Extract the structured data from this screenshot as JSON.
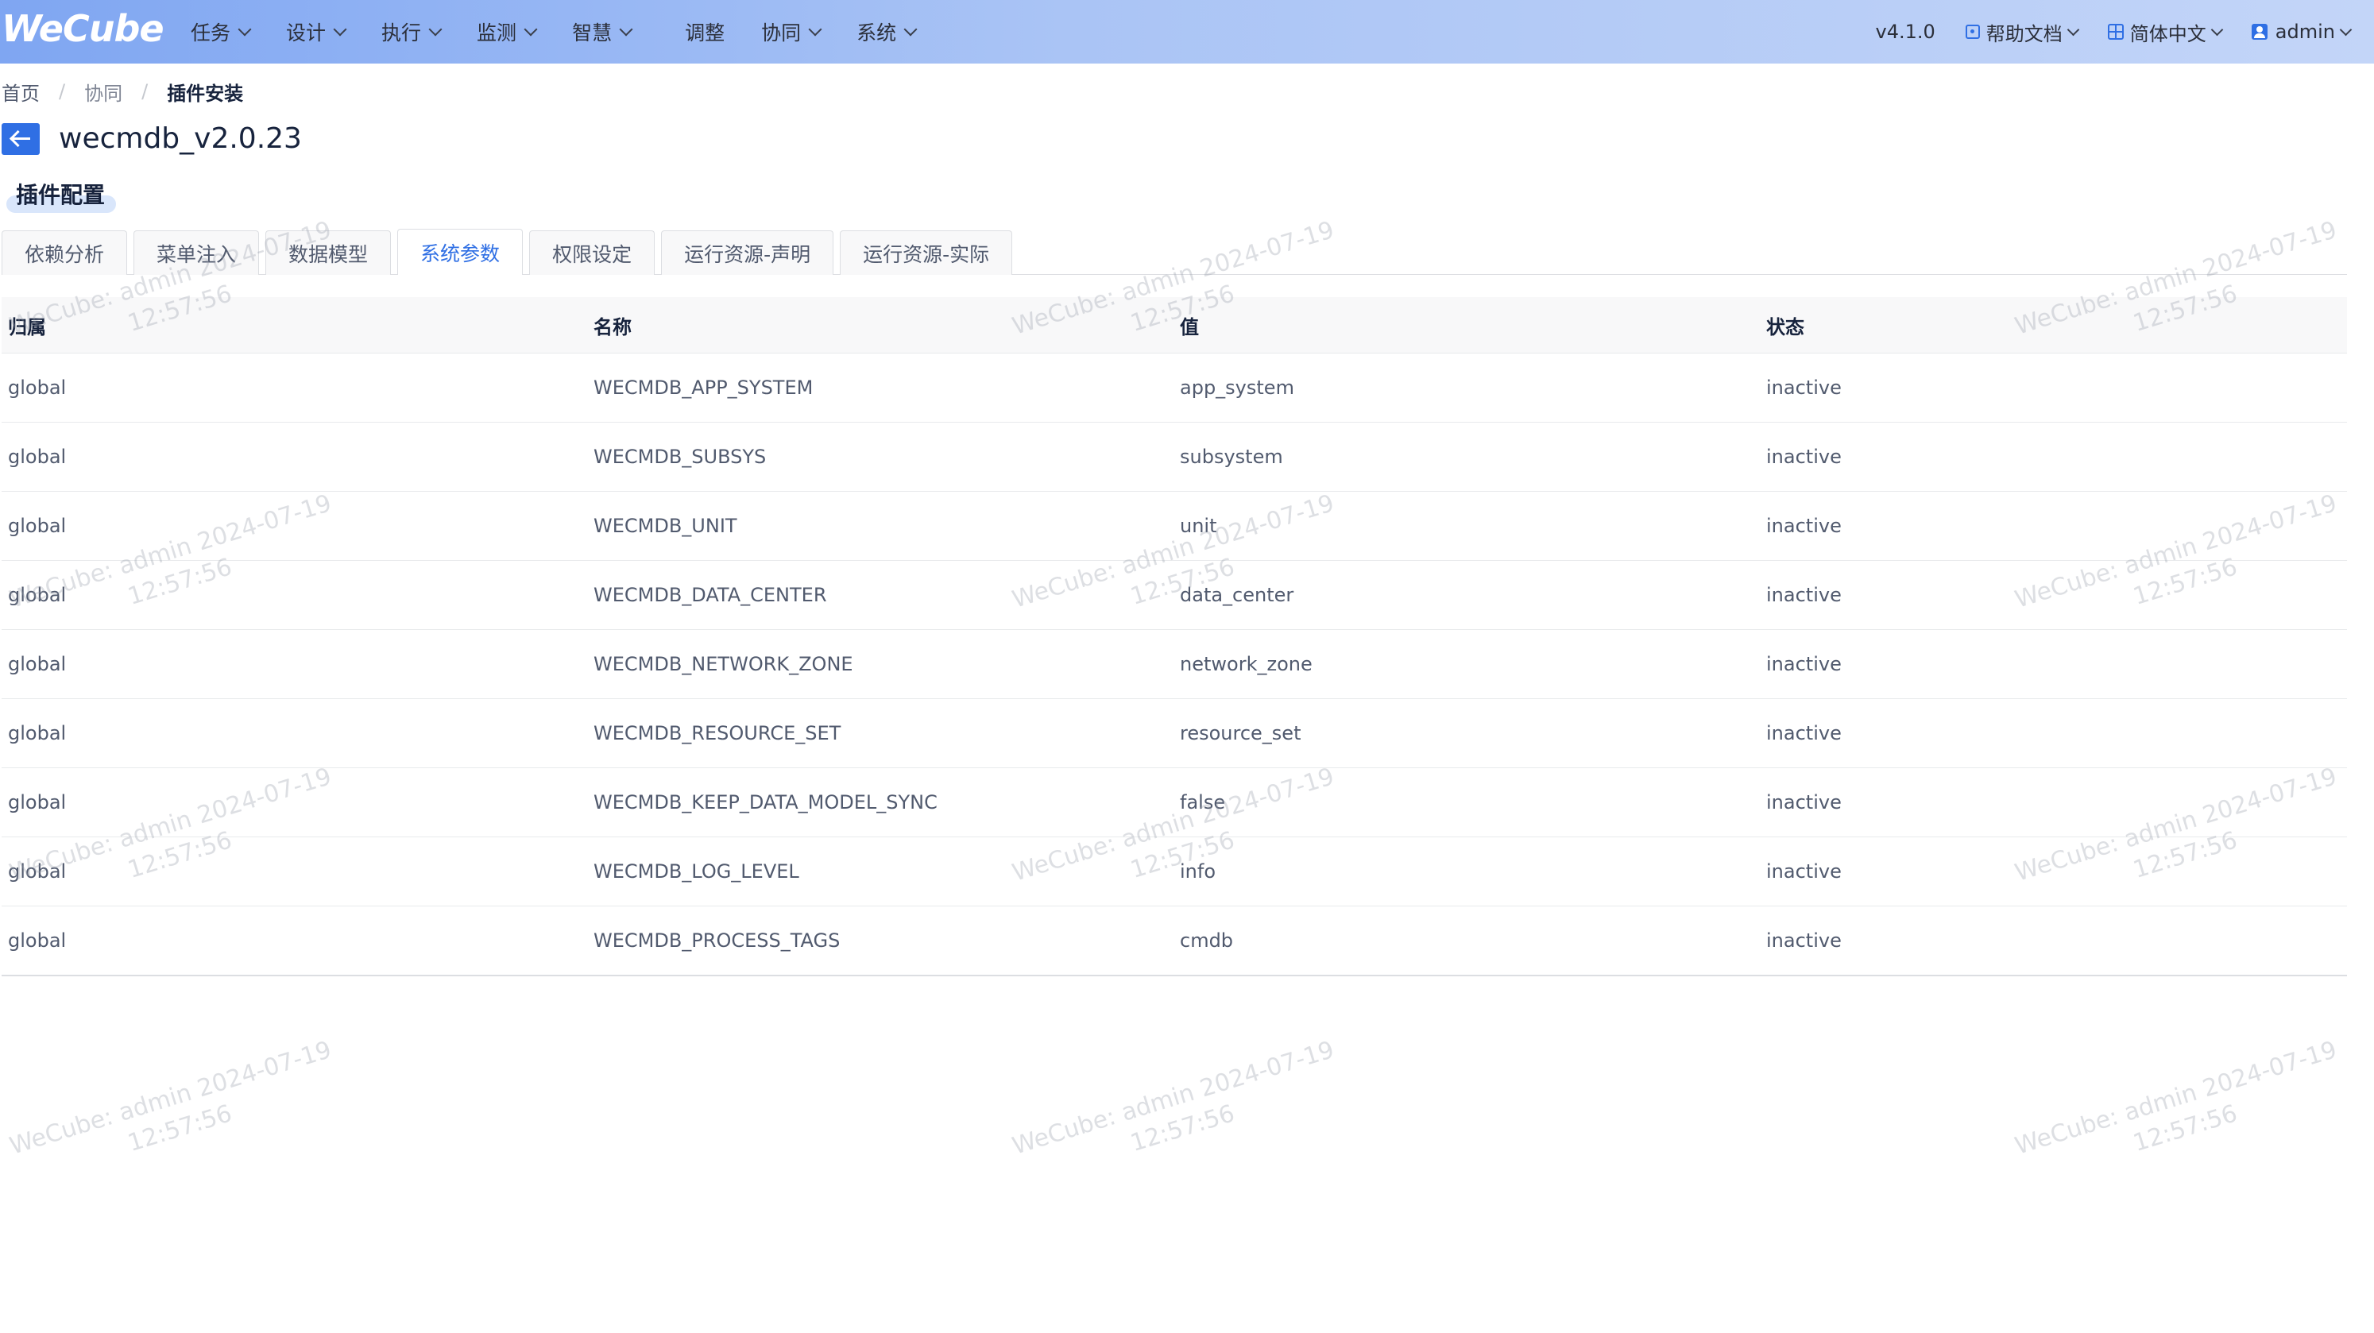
{
  "app": {
    "logo_text": "WeCube",
    "version": "v4.1.0"
  },
  "nav": {
    "items": [
      {
        "label": "任务",
        "has_dropdown": true
      },
      {
        "label": "设计",
        "has_dropdown": true
      },
      {
        "label": "执行",
        "has_dropdown": true
      },
      {
        "label": "监测",
        "has_dropdown": true
      },
      {
        "label": "智慧",
        "has_dropdown": true
      },
      {
        "label": "调整",
        "has_dropdown": false
      },
      {
        "label": "协同",
        "has_dropdown": true
      },
      {
        "label": "系统",
        "has_dropdown": true
      }
    ],
    "help_label": "帮助文档",
    "language_label": "简体中文",
    "user_label": "admin"
  },
  "breadcrumb": [
    "首页",
    "协同",
    "插件安装"
  ],
  "page": {
    "title": "wecmdb_v2.0.23",
    "section_label": "插件配置"
  },
  "tabs": [
    {
      "label": "依赖分析",
      "active": false
    },
    {
      "label": "菜单注入",
      "active": false
    },
    {
      "label": "数据模型",
      "active": false
    },
    {
      "label": "系统参数",
      "active": true
    },
    {
      "label": "权限设定",
      "active": false
    },
    {
      "label": "运行资源-声明",
      "active": false
    },
    {
      "label": "运行资源-实际",
      "active": false
    }
  ],
  "table": {
    "columns": [
      "归属",
      "名称",
      "值",
      "状态"
    ],
    "rows": [
      [
        "global",
        "WECMDB_APP_SYSTEM",
        "app_system",
        "inactive"
      ],
      [
        "global",
        "WECMDB_SUBSYS",
        "subsystem",
        "inactive"
      ],
      [
        "global",
        "WECMDB_UNIT",
        "unit",
        "inactive"
      ],
      [
        "global",
        "WECMDB_DATA_CENTER",
        "data_center",
        "inactive"
      ],
      [
        "global",
        "WECMDB_NETWORK_ZONE",
        "network_zone",
        "inactive"
      ],
      [
        "global",
        "WECMDB_RESOURCE_SET",
        "resource_set",
        "inactive"
      ],
      [
        "global",
        "WECMDB_KEEP_DATA_MODEL_SYNC",
        "false",
        "inactive"
      ],
      [
        "global",
        "WECMDB_LOG_LEVEL",
        "info",
        "inactive"
      ],
      [
        "global",
        "WECMDB_PROCESS_TAGS",
        "cmdb",
        "inactive"
      ]
    ]
  },
  "watermark": {
    "line1": "WeCube: admin 2024-07-19",
    "line2": "12:57:56"
  },
  "colors": {
    "accent": "#2f6fe4",
    "nav_gradient_start": "#7fa6f2",
    "nav_gradient_end": "#c3d5f8"
  }
}
